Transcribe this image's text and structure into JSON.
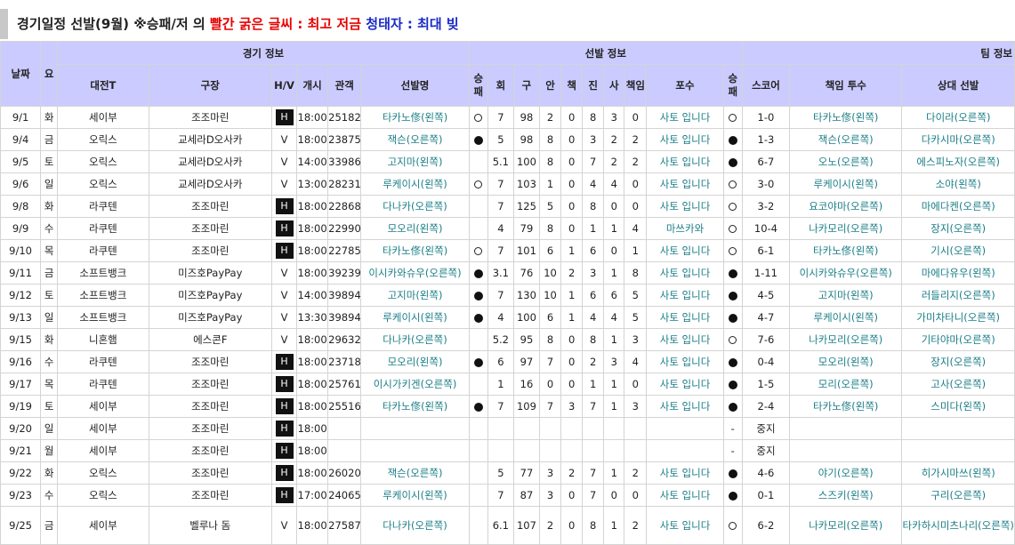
{
  "title": {
    "main": "경기일정 선발(9월)",
    "sep": " ※승패/저 의 ",
    "red_part": "빨간 굵은 글씨 : 최고 저금",
    "blue_part": " 청태자 : 최대 빚"
  },
  "header": {
    "date": "날짜",
    "day": "요",
    "game_info": "경기 정보",
    "starter_info": "선발 정보",
    "team_info": "팀 정보",
    "opponent": "대전T",
    "stadium": "구장",
    "hv": "H/V",
    "start": "개시",
    "attendance": "관객",
    "starter": "선발명",
    "wl": "승패",
    "innings": "회",
    "pitches": "구",
    "hits": "안",
    "runs": "책",
    "earned": "진",
    "walks": "사",
    "er": "책임",
    "catcher": "포수",
    "team_wl": "승패",
    "score": "스코어",
    "resp_pitcher": "책임 투수",
    "opp_starter": "상대 선발"
  },
  "rows": [
    {
      "date": "9/1",
      "day": "화",
      "opp": "세이부",
      "park": "조조마린",
      "hv": "H",
      "start": "18:00",
      "att": "25182",
      "sp": "타카노俢(왼쪽)",
      "wl": "o",
      "ip": "7",
      "np": "98",
      "h": "2",
      "r": "0",
      "er": "8",
      "bb": "3",
      "k": "0",
      "c": "사토 입니다",
      "twl": "o",
      "score": "1-0",
      "rp": "타카노俢(왼쪽)",
      "os": "다이라(오른쪽)"
    },
    {
      "date": "9/4",
      "day": "금",
      "opp": "오릭스",
      "park": "교세라D오사카",
      "hv": "V",
      "start": "18:00",
      "att": "23875",
      "sp": "잭슨(오른쪽)",
      "wl": "f",
      "ip": "5",
      "np": "98",
      "h": "8",
      "r": "0",
      "er": "3",
      "bb": "2",
      "k": "2",
      "c": "사토 입니다",
      "twl": "f",
      "score": "1-3",
      "rp": "잭슨(오른쪽)",
      "os": "다카시마(오른쪽)"
    },
    {
      "date": "9/5",
      "day": "토",
      "opp": "오릭스",
      "park": "교세라D오사카",
      "hv": "V",
      "start": "14:00",
      "att": "33986",
      "sp": "고지마(왼쪽)",
      "wl": "",
      "ip": "5.1",
      "np": "100",
      "h": "8",
      "r": "0",
      "er": "7",
      "bb": "2",
      "k": "2",
      "c": "사토 입니다",
      "twl": "f",
      "score": "6-7",
      "rp": "오노(오른쪽)",
      "os": "에스피노자(오른쪽)"
    },
    {
      "date": "9/6",
      "day": "일",
      "opp": "오릭스",
      "park": "교세라D오사카",
      "hv": "V",
      "start": "13:00",
      "att": "28231",
      "sp": "루케이시(왼쪽)",
      "wl": "o",
      "ip": "7",
      "np": "103",
      "h": "1",
      "r": "0",
      "er": "4",
      "bb": "4",
      "k": "0",
      "c": "사토 입니다",
      "twl": "o",
      "score": "3-0",
      "rp": "루케이시(왼쪽)",
      "os": "소야(왼쪽)"
    },
    {
      "date": "9/8",
      "day": "화",
      "opp": "라쿠텐",
      "park": "조조마린",
      "hv": "H",
      "start": "18:00",
      "att": "22868",
      "sp": "다나카(오른쪽)",
      "wl": "",
      "ip": "7",
      "np": "125",
      "h": "5",
      "r": "0",
      "er": "8",
      "bb": "0",
      "k": "0",
      "c": "사토 입니다",
      "twl": "o",
      "score": "3-2",
      "rp": "요코야마(오른쪽)",
      "os": "마에다켄(오른쪽)"
    },
    {
      "date": "9/9",
      "day": "수",
      "opp": "라쿠텐",
      "park": "조조마린",
      "hv": "H",
      "start": "18:00",
      "att": "22990",
      "sp": "모오리(왼쪽)",
      "wl": "",
      "ip": "4",
      "np": "79",
      "h": "8",
      "r": "0",
      "er": "1",
      "bb": "1",
      "k": "4",
      "c": "마쓰카와",
      "twl": "o",
      "score": "10-4",
      "rp": "나카모리(오른쪽)",
      "os": "장지(오른쪽)"
    },
    {
      "date": "9/10",
      "day": "목",
      "opp": "라쿠텐",
      "park": "조조마린",
      "hv": "H",
      "start": "18:00",
      "att": "22785",
      "sp": "타카노俢(왼쪽)",
      "wl": "o",
      "ip": "7",
      "np": "101",
      "h": "6",
      "r": "1",
      "er": "6",
      "bb": "0",
      "k": "1",
      "c": "사토 입니다",
      "twl": "o",
      "score": "6-1",
      "rp": "타카노俢(왼쪽)",
      "os": "기시(오른쪽)"
    },
    {
      "date": "9/11",
      "day": "금",
      "opp": "소프트뱅크",
      "park": "미즈호PayPay",
      "hv": "V",
      "start": "18:00",
      "att": "39239",
      "sp": "이시카와슈우(오른쪽)",
      "wl": "f",
      "ip": "3.1",
      "np": "76",
      "h": "10",
      "r": "2",
      "er": "3",
      "bb": "1",
      "k": "8",
      "c": "사토 입니다",
      "twl": "f",
      "score": "1-11",
      "rp": "이시카와슈우(오른쪽)",
      "os": "마에다유우(왼쪽)"
    },
    {
      "date": "9/12",
      "day": "토",
      "opp": "소프트뱅크",
      "park": "미즈호PayPay",
      "hv": "V",
      "start": "14:00",
      "att": "39894",
      "sp": "고지마(왼쪽)",
      "wl": "f",
      "ip": "7",
      "np": "130",
      "h": "10",
      "r": "1",
      "er": "6",
      "bb": "6",
      "k": "5",
      "c": "사토 입니다",
      "twl": "f",
      "score": "4-5",
      "rp": "고지마(왼쪽)",
      "os": "러들리지(오른쪽)"
    },
    {
      "date": "9/13",
      "day": "일",
      "opp": "소프트뱅크",
      "park": "미즈호PayPay",
      "hv": "V",
      "start": "13:30",
      "att": "39894",
      "sp": "루케이시(왼쪽)",
      "wl": "f",
      "ip": "4",
      "np": "100",
      "h": "6",
      "r": "1",
      "er": "4",
      "bb": "4",
      "k": "5",
      "c": "사토 입니다",
      "twl": "f",
      "score": "4-7",
      "rp": "루케이시(왼쪽)",
      "os": "가미차타니(오른쪽)"
    },
    {
      "date": "9/15",
      "day": "화",
      "opp": "니혼햄",
      "park": "에스콘F",
      "hv": "V",
      "start": "18:00",
      "att": "29632",
      "sp": "다나카(오른쪽)",
      "wl": "",
      "ip": "5.2",
      "np": "95",
      "h": "8",
      "r": "0",
      "er": "8",
      "bb": "1",
      "k": "3",
      "c": "사토 입니다",
      "twl": "o",
      "score": "7-6",
      "rp": "나카모리(오른쪽)",
      "os": "기타야마(오른쪽)"
    },
    {
      "date": "9/16",
      "day": "수",
      "opp": "라쿠텐",
      "park": "조조마린",
      "hv": "H",
      "start": "18:00",
      "att": "23718",
      "sp": "모오리(왼쪽)",
      "wl": "f",
      "ip": "6",
      "np": "97",
      "h": "7",
      "r": "0",
      "er": "2",
      "bb": "3",
      "k": "4",
      "c": "사토 입니다",
      "twl": "f",
      "score": "0-4",
      "rp": "모오리(왼쪽)",
      "os": "장지(오른쪽)"
    },
    {
      "date": "9/17",
      "day": "목",
      "opp": "라쿠텐",
      "park": "조조마린",
      "hv": "H",
      "start": "18:00",
      "att": "25761",
      "sp": "이시가키겐(오른쪽)",
      "wl": "",
      "ip": "1",
      "np": "16",
      "h": "0",
      "r": "0",
      "er": "1",
      "bb": "1",
      "k": "0",
      "c": "사토 입니다",
      "twl": "f",
      "score": "1-5",
      "rp": "모리(오른쪽)",
      "os": "고사(오른쪽)"
    },
    {
      "date": "9/19",
      "day": "토",
      "opp": "세이부",
      "park": "조조마린",
      "hv": "H",
      "start": "18:00",
      "att": "25516",
      "sp": "타카노俢(왼쪽)",
      "wl": "f",
      "ip": "7",
      "np": "109",
      "h": "7",
      "r": "3",
      "er": "7",
      "bb": "1",
      "k": "3",
      "c": "사토 입니다",
      "twl": "f",
      "score": "2-4",
      "rp": "타카노俢(왼쪽)",
      "os": "스미다(왼쪽)"
    },
    {
      "date": "9/20",
      "day": "일",
      "opp": "세이부",
      "park": "조조마린",
      "hv": "H",
      "start": "18:00",
      "att": "",
      "sp": "",
      "wl": "",
      "ip": "",
      "np": "",
      "h": "",
      "r": "",
      "er": "",
      "bb": "",
      "k": "",
      "c": "",
      "twl": "-",
      "score": "중지",
      "rp": "",
      "os": ""
    },
    {
      "date": "9/21",
      "day": "월",
      "opp": "세이부",
      "park": "조조마린",
      "hv": "H",
      "start": "18:00",
      "att": "",
      "sp": "",
      "wl": "",
      "ip": "",
      "np": "",
      "h": "",
      "r": "",
      "er": "",
      "bb": "",
      "k": "",
      "c": "",
      "twl": "-",
      "score": "중지",
      "rp": "",
      "os": ""
    },
    {
      "date": "9/22",
      "day": "화",
      "opp": "오릭스",
      "park": "조조마린",
      "hv": "H",
      "start": "18:00",
      "att": "26020",
      "sp": "잭슨(오른쪽)",
      "wl": "",
      "ip": "5",
      "np": "77",
      "h": "3",
      "r": "2",
      "er": "7",
      "bb": "1",
      "k": "2",
      "c": "사토 입니다",
      "twl": "f",
      "score": "4-6",
      "rp": "야기(오른쪽)",
      "os": "히가시마쓰(왼쪽)"
    },
    {
      "date": "9/23",
      "day": "수",
      "opp": "오릭스",
      "park": "조조마린",
      "hv": "H",
      "start": "17:00",
      "att": "24065",
      "sp": "루케이시(왼쪽)",
      "wl": "",
      "ip": "7",
      "np": "87",
      "h": "3",
      "r": "0",
      "er": "7",
      "bb": "0",
      "k": "0",
      "c": "사토 입니다",
      "twl": "f",
      "score": "0-1",
      "rp": "스즈키(왼쪽)",
      "os": "구리(오른쪽)"
    },
    {
      "date": "9/25",
      "day": "금",
      "opp": "세이부",
      "park": "벨루나 돔",
      "hv": "V",
      "start": "18:00",
      "att": "27587",
      "sp": "다나카(오른쪽)",
      "wl": "",
      "ip": "6.1",
      "np": "107",
      "h": "2",
      "r": "0",
      "er": "8",
      "bb": "1",
      "k": "2",
      "c": "사토 입니다",
      "twl": "o",
      "score": "6-2",
      "rp": "나카모리(오른쪽)",
      "os": "타카하시미츠나리(오른쪽)"
    }
  ]
}
